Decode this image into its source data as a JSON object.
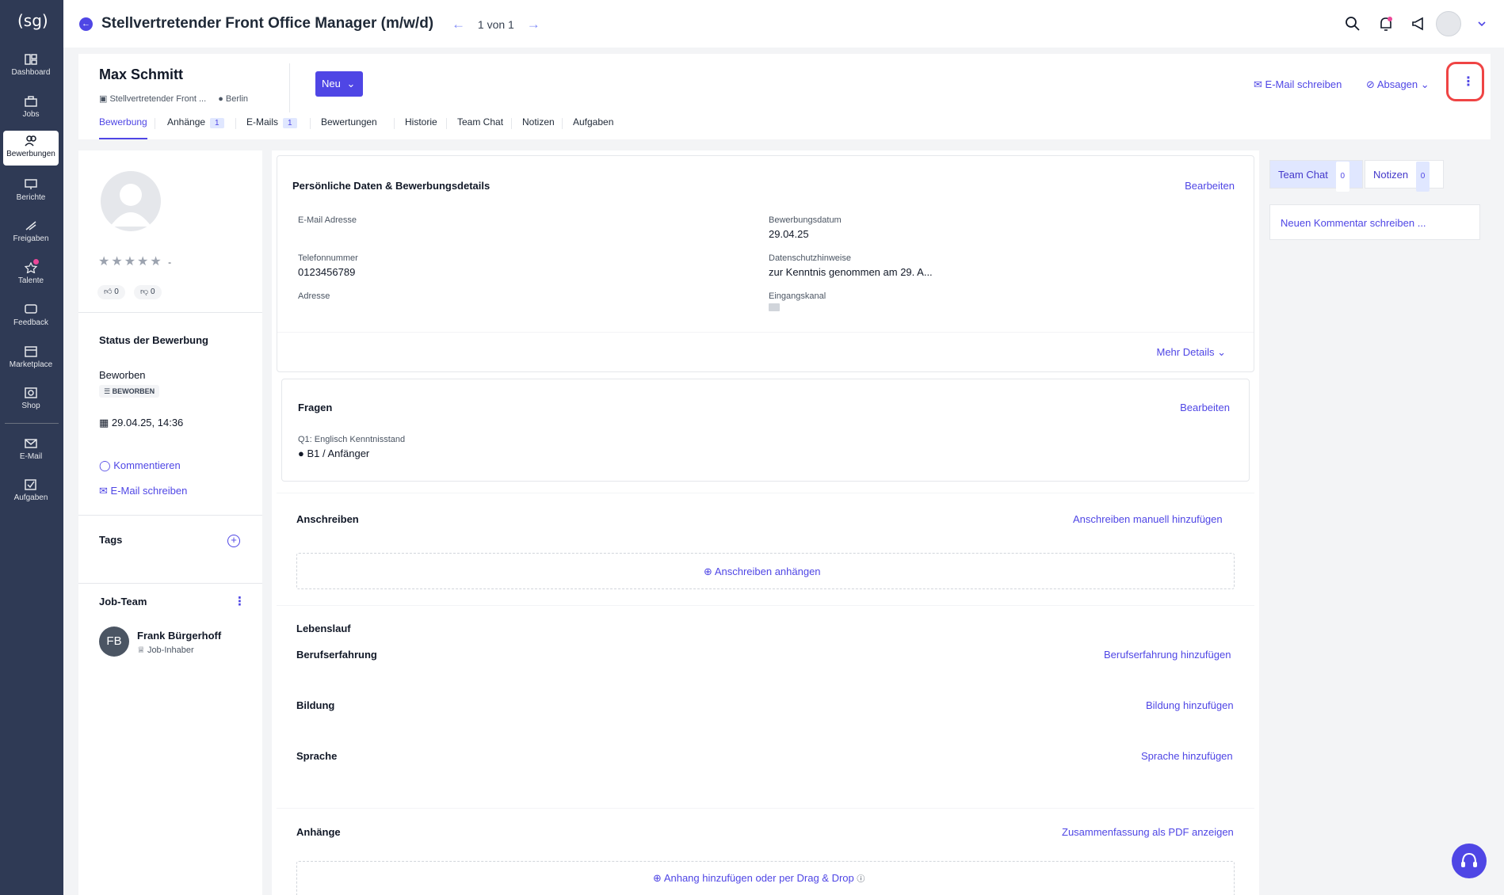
{
  "sidebar": {
    "logo": "(sg)",
    "items": [
      {
        "label": "Dashboard",
        "icon": "dashboard-icon"
      },
      {
        "label": "Jobs",
        "icon": "briefcase-icon"
      },
      {
        "label": "Bewerbungen",
        "icon": "users-icon",
        "active": true
      },
      {
        "label": "Berichte",
        "icon": "chart-icon"
      },
      {
        "label": "Freigaben",
        "icon": "approval-icon"
      },
      {
        "label": "Talente",
        "icon": "star-icon"
      },
      {
        "label": "Feedback",
        "icon": "feedback-icon"
      },
      {
        "label": "Marketplace",
        "icon": "store-icon"
      },
      {
        "label": "Shop",
        "icon": "shop-icon"
      },
      {
        "label": "E-Mail",
        "icon": "mail-icon"
      },
      {
        "label": "Aufgaben",
        "icon": "tasks-icon"
      }
    ]
  },
  "topbar": {
    "title": "Stellvertretender Front Office Manager (m/w/d)",
    "pager": "1 von 1"
  },
  "candidate": {
    "name": "Max Schmitt",
    "job": "Stellvertretender Front ...",
    "location": "Berlin",
    "status_button": "Neu",
    "email_action": "E-Mail schreiben",
    "reject_action": "Absagen"
  },
  "tabs": [
    {
      "label": "Bewerbung",
      "active": true
    },
    {
      "label": "Anhänge",
      "badge": "1"
    },
    {
      "label": "E-Mails",
      "badge": "1"
    },
    {
      "label": "Bewertungen"
    },
    {
      "label": "Historie"
    },
    {
      "label": "Team Chat"
    },
    {
      "label": "Notizen"
    },
    {
      "label": "Aufgaben"
    }
  ],
  "left": {
    "rating_value": "-",
    "thumbs_up": "0",
    "thumbs_down": "0",
    "status_title": "Status der Bewerbung",
    "status": "Beworben",
    "status_badge": "BEWORBEN",
    "date": "29.04.25, 14:36",
    "comment_link": "Kommentieren",
    "email_link": "E-Mail schreiben",
    "tags_title": "Tags",
    "team_title": "Job-Team",
    "member_initials": "FB",
    "member_name": "Frank Bürgerhoff",
    "member_role": "Job-Inhaber"
  },
  "personal": {
    "title": "Persönliche Daten & Bewerbungsdetails",
    "edit": "Bearbeiten",
    "email_label": "E-Mail Adresse",
    "phone_label": "Telefonnummer",
    "phone": "0123456789",
    "address_label": "Adresse",
    "applied_label": "Bewerbungsdatum",
    "applied": "29.04.25",
    "privacy_label": "Datenschutzhinweise",
    "privacy": "zur Kenntnis genommen am 29. A...",
    "channel_label": "Eingangskanal",
    "more": "Mehr Details"
  },
  "questions": {
    "title": "Fragen",
    "edit": "Bearbeiten",
    "q1_label": "Q1: Englisch Kenntnisstand",
    "q1_answer": "B1 / Anfänger"
  },
  "cover": {
    "title": "Anschreiben",
    "add_manual": "Anschreiben manuell hinzufügen",
    "attach": "Anschreiben anhängen"
  },
  "cv": {
    "title": "Lebenslauf",
    "experience": "Berufserfahrung",
    "experience_add": "Berufserfahrung hinzufügen",
    "education": "Bildung",
    "education_add": "Bildung hinzufügen",
    "language": "Sprache",
    "language_add": "Sprache hinzufügen"
  },
  "attachments": {
    "title": "Anhänge",
    "pdf_link": "Zusammenfassung als PDF anzeigen",
    "add": "Anhang hinzufügen oder per Drag & Drop"
  },
  "right": {
    "team_chat": "Team Chat",
    "team_chat_count": "0",
    "notes": "Notizen",
    "notes_count": "0",
    "comment_placeholder": "Neuen Kommentar schreiben ..."
  },
  "colors": {
    "primary": "#4f46e5",
    "sidebar": "#2f3a55",
    "highlight": "#ef4444"
  }
}
